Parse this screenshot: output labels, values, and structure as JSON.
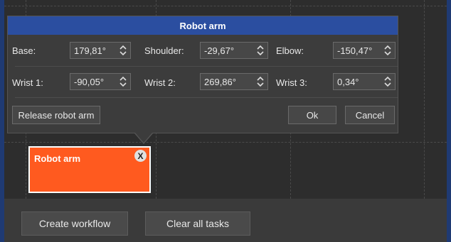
{
  "dialog": {
    "title": "Robot arm",
    "row1": [
      {
        "label": "Base:",
        "value": "179,81°"
      },
      {
        "label": "Shoulder:",
        "value": "-29,67°"
      },
      {
        "label": "Elbow:",
        "value": "-150,47°"
      }
    ],
    "row2": [
      {
        "label": "Wrist 1:",
        "value": "-90,05°"
      },
      {
        "label": "Wrist 2:",
        "value": "269,86°"
      },
      {
        "label": "Wrist 3:",
        "value": "0,34°"
      }
    ],
    "release_label": "Release robot arm",
    "ok_label": "Ok",
    "cancel_label": "Cancel"
  },
  "task_card": {
    "title": "Robot arm",
    "close_glyph": "X",
    "color": "#ff5a1f"
  },
  "toolbar": {
    "create_workflow_label": "Create workflow",
    "clear_tasks_label": "Clear all tasks"
  },
  "colors": {
    "title_bar": "#2b4ea0",
    "accent_strip": "#1f3a73"
  },
  "icons": {
    "spinner": "chevron-up-down-icon",
    "close": "close-icon"
  }
}
